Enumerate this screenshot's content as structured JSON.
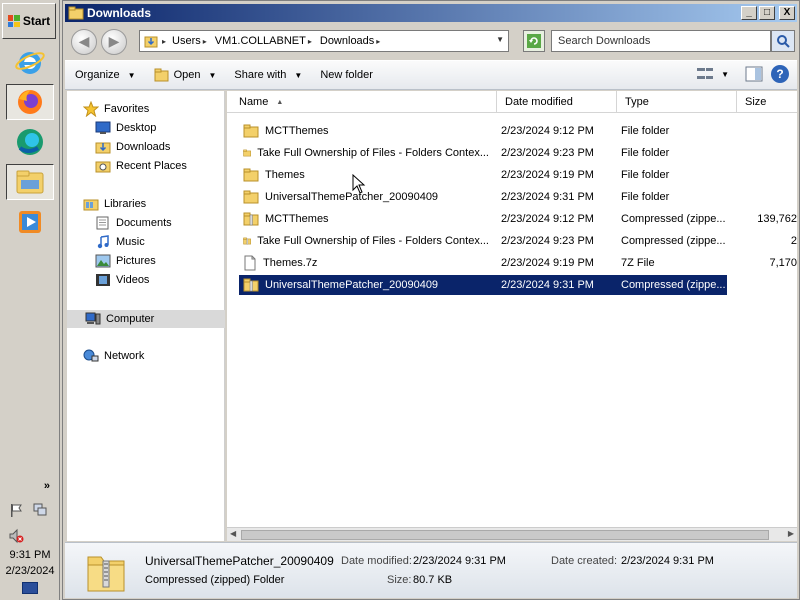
{
  "taskbar": {
    "start_label": "Start",
    "apps": [
      {
        "name": "Internet Explorer",
        "icon": "ie-icon"
      },
      {
        "name": "Firefox",
        "icon": "firefox-icon"
      },
      {
        "name": "Edge",
        "icon": "edge-icon"
      },
      {
        "name": "Windows Explorer",
        "icon": "explorer-icon"
      },
      {
        "name": "Media Player",
        "icon": "media-player-icon"
      }
    ],
    "tray": {
      "expand_label": "»",
      "time": "9:31 PM",
      "date": "2/23/2024"
    }
  },
  "window": {
    "title": "Downloads",
    "controls": {
      "minimize": "_",
      "maximize": "□",
      "close": "X"
    },
    "address": {
      "crumbs": [
        "Users",
        "VM1.COLLABNET",
        "Downloads"
      ]
    },
    "search_placeholder": "Search Downloads",
    "commands": {
      "organize": "Organize",
      "open": "Open",
      "share_with": "Share with",
      "new_folder": "New folder"
    },
    "nav": {
      "favorites": "Favorites",
      "desktop": "Desktop",
      "downloads": "Downloads",
      "recent_places": "Recent Places",
      "libraries": "Libraries",
      "documents": "Documents",
      "music": "Music",
      "pictures": "Pictures",
      "videos": "Videos",
      "computer": "Computer",
      "network": "Network"
    },
    "columns": {
      "name": "Name",
      "date_modified": "Date modified",
      "type": "Type",
      "size": "Size"
    },
    "files": [
      {
        "name": "MCTThemes",
        "date": "2/23/2024 9:12 PM",
        "type": "File folder",
        "size": "",
        "kind": "folder"
      },
      {
        "name": "Take Full Ownership of Files - Folders Contex...",
        "date": "2/23/2024 9:23 PM",
        "type": "File folder",
        "size": "",
        "kind": "folder"
      },
      {
        "name": "Themes",
        "date": "2/23/2024 9:19 PM",
        "type": "File folder",
        "size": "",
        "kind": "folder"
      },
      {
        "name": "UniversalThemePatcher_20090409",
        "date": "2/23/2024 9:31 PM",
        "type": "File folder",
        "size": "",
        "kind": "folder"
      },
      {
        "name": "MCTThemes",
        "date": "2/23/2024 9:12 PM",
        "type": "Compressed (zippe...",
        "size": "139,762",
        "kind": "zip"
      },
      {
        "name": "Take Full Ownership of Files - Folders Contex...",
        "date": "2/23/2024 9:23 PM",
        "type": "Compressed (zippe...",
        "size": "2",
        "kind": "zip"
      },
      {
        "name": "Themes.7z",
        "date": "2/23/2024 9:19 PM",
        "type": "7Z File",
        "size": "7,170",
        "kind": "file"
      },
      {
        "name": "UniversalThemePatcher_20090409",
        "date": "2/23/2024 9:31 PM",
        "type": "Compressed (zippe...",
        "size": "81",
        "kind": "zip"
      }
    ],
    "details": {
      "name": "UniversalThemePatcher_20090409",
      "type": "Compressed (zipped) Folder",
      "date_modified_label": "Date modified:",
      "date_modified": "2/23/2024 9:31 PM",
      "date_created_label": "Date created:",
      "date_created": "2/23/2024 9:31 PM",
      "size_label": "Size:",
      "size": "80.7 KB"
    }
  },
  "colors": {
    "selection": "#0a246a",
    "title_gradient_start": "#0a246a",
    "folder_yellow": "#f3d06a"
  }
}
